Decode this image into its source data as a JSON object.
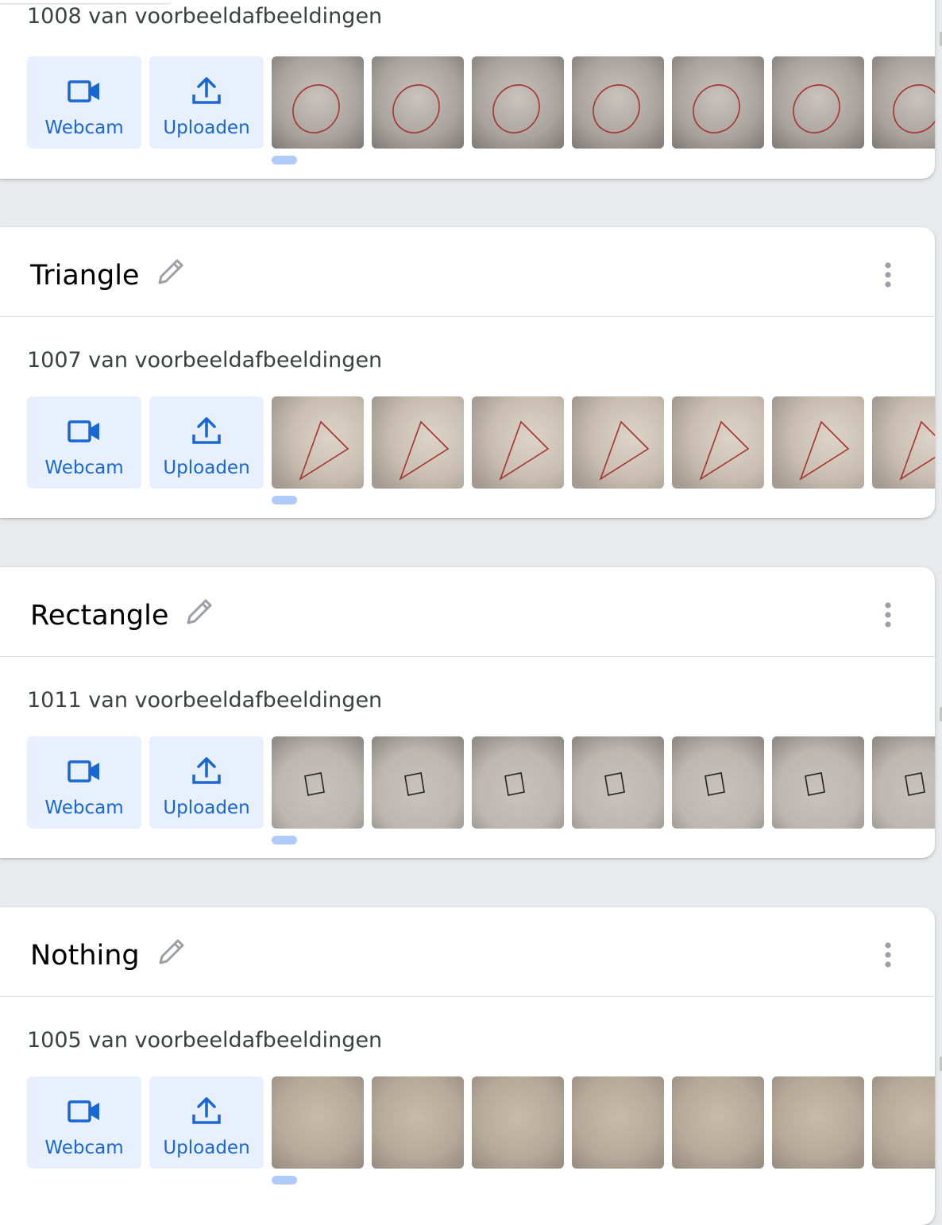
{
  "classes": [
    {
      "name": "",
      "count_label": "1008 van voorbeeldafbeeldingen",
      "shape": "circle",
      "webcam_label": "Webcam",
      "upload_label": "Uploaden",
      "thumbnail_count": 7
    },
    {
      "name": "Triangle",
      "count_label": "1007 van voorbeeldafbeeldingen",
      "shape": "triangle",
      "webcam_label": "Webcam",
      "upload_label": "Uploaden",
      "thumbnail_count": 7
    },
    {
      "name": "Rectangle",
      "count_label": "1011 van voorbeeldafbeeldingen",
      "shape": "square",
      "webcam_label": "Webcam",
      "upload_label": "Uploaden",
      "thumbnail_count": 7
    },
    {
      "name": "Nothing",
      "count_label": "1005 van voorbeeldafbeeldingen",
      "shape": "none",
      "webcam_label": "Webcam",
      "upload_label": "Uploaden",
      "thumbnail_count": 7
    }
  ],
  "icons": {
    "webcam": "videocam-icon",
    "upload": "upload-icon",
    "edit": "pencil-icon",
    "more": "more-vert-icon"
  },
  "colors": {
    "accent": "#1967d2",
    "button_bg": "#e8f0fe",
    "page_bg": "#e8eaed",
    "scroll_pill": "#aecbfa",
    "drawing_red": "#a8312e"
  }
}
